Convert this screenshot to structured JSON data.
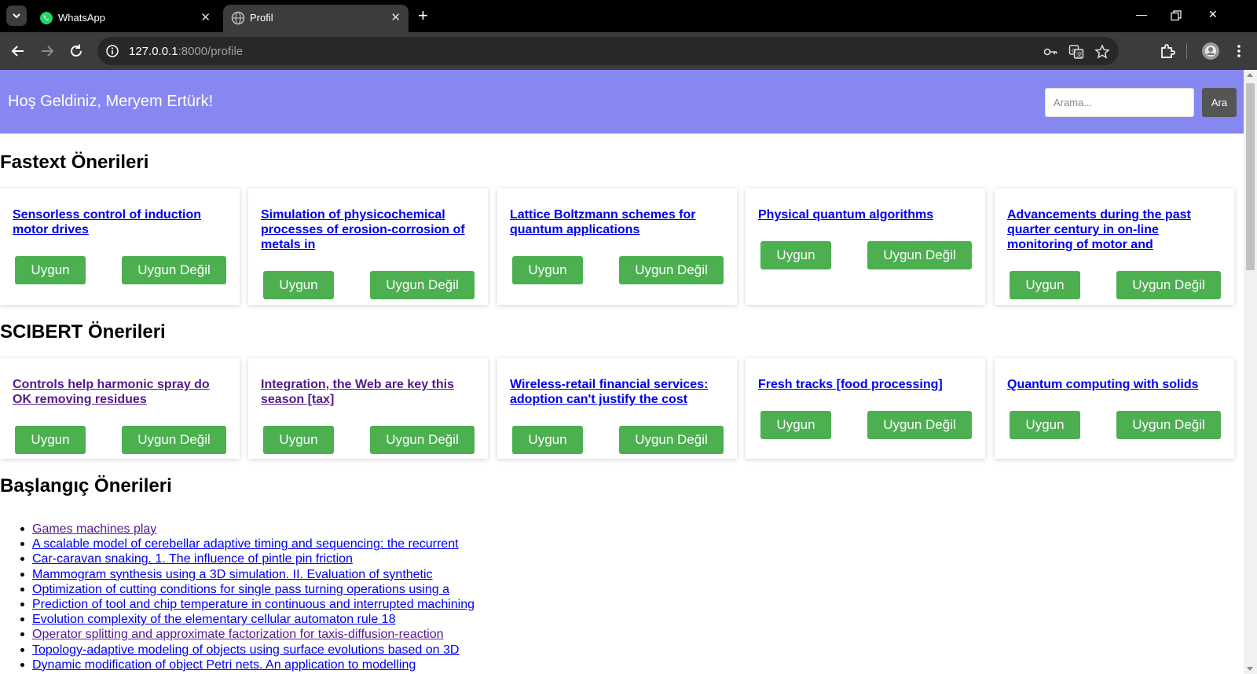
{
  "browser": {
    "tabs": [
      {
        "title": "WhatsApp",
        "active": false,
        "icon": "whatsapp-icon"
      },
      {
        "title": "Profil",
        "active": true,
        "icon": "globe-icon"
      }
    ],
    "url_host": "127.0.0.1",
    "url_path": ":8000/profile"
  },
  "header": {
    "welcome": "Hoş Geldiniz, Meryem Ertürk!",
    "search_placeholder": "Arama...",
    "search_button": "Ara",
    "background_color": "#8787f2"
  },
  "buttons": {
    "yes": "Uygun",
    "no": "Uygun Değil",
    "color": "#4caf50"
  },
  "fastext": {
    "title": "Fastext Önerileri",
    "items": [
      {
        "title": "Sensorless control of induction motor drives",
        "visited": false
      },
      {
        "title": "Simulation of physicochemical processes of erosion-corrosion of metals in",
        "visited": false
      },
      {
        "title": "Lattice Boltzmann schemes for quantum applications",
        "visited": false
      },
      {
        "title": "Physical quantum algorithms",
        "visited": false
      },
      {
        "title": "Advancements during the past quarter century in on-line monitoring of motor and",
        "visited": false
      }
    ]
  },
  "scibert": {
    "title": "SCIBERT Önerileri",
    "items": [
      {
        "title": "Controls help harmonic spray do OK removing residues",
        "visited": true
      },
      {
        "title": "Integration, the Web are key this season [tax]",
        "visited": true
      },
      {
        "title": "Wireless-retail financial services: adoption can't justify the cost",
        "visited": false
      },
      {
        "title": "Fresh tracks [food processing]",
        "visited": false
      },
      {
        "title": "Quantum computing with solids",
        "visited": false
      }
    ]
  },
  "start": {
    "title": "Başlangıç Önerileri",
    "items": [
      {
        "title": "Games machines play",
        "visited": true
      },
      {
        "title": "A scalable model of cerebellar adaptive timing and sequencing: the recurrent",
        "visited": false
      },
      {
        "title": "Car-caravan snaking. 1. The influence of pintle pin friction",
        "visited": false
      },
      {
        "title": "Mammogram synthesis using a 3D simulation. II. Evaluation of synthetic",
        "visited": false
      },
      {
        "title": "Optimization of cutting conditions for single pass turning operations using a",
        "visited": false
      },
      {
        "title": "Prediction of tool and chip temperature in continuous and interrupted machining",
        "visited": false
      },
      {
        "title": "Evolution complexity of the elementary cellular automaton rule 18",
        "visited": false
      },
      {
        "title": "Operator splitting and approximate factorization for taxis-diffusion-reaction",
        "visited": true
      },
      {
        "title": "Topology-adaptive modeling of objects using surface evolutions based on 3D",
        "visited": false
      },
      {
        "title": "Dynamic modification of object Petri nets. An application to modelling",
        "visited": false
      }
    ]
  }
}
